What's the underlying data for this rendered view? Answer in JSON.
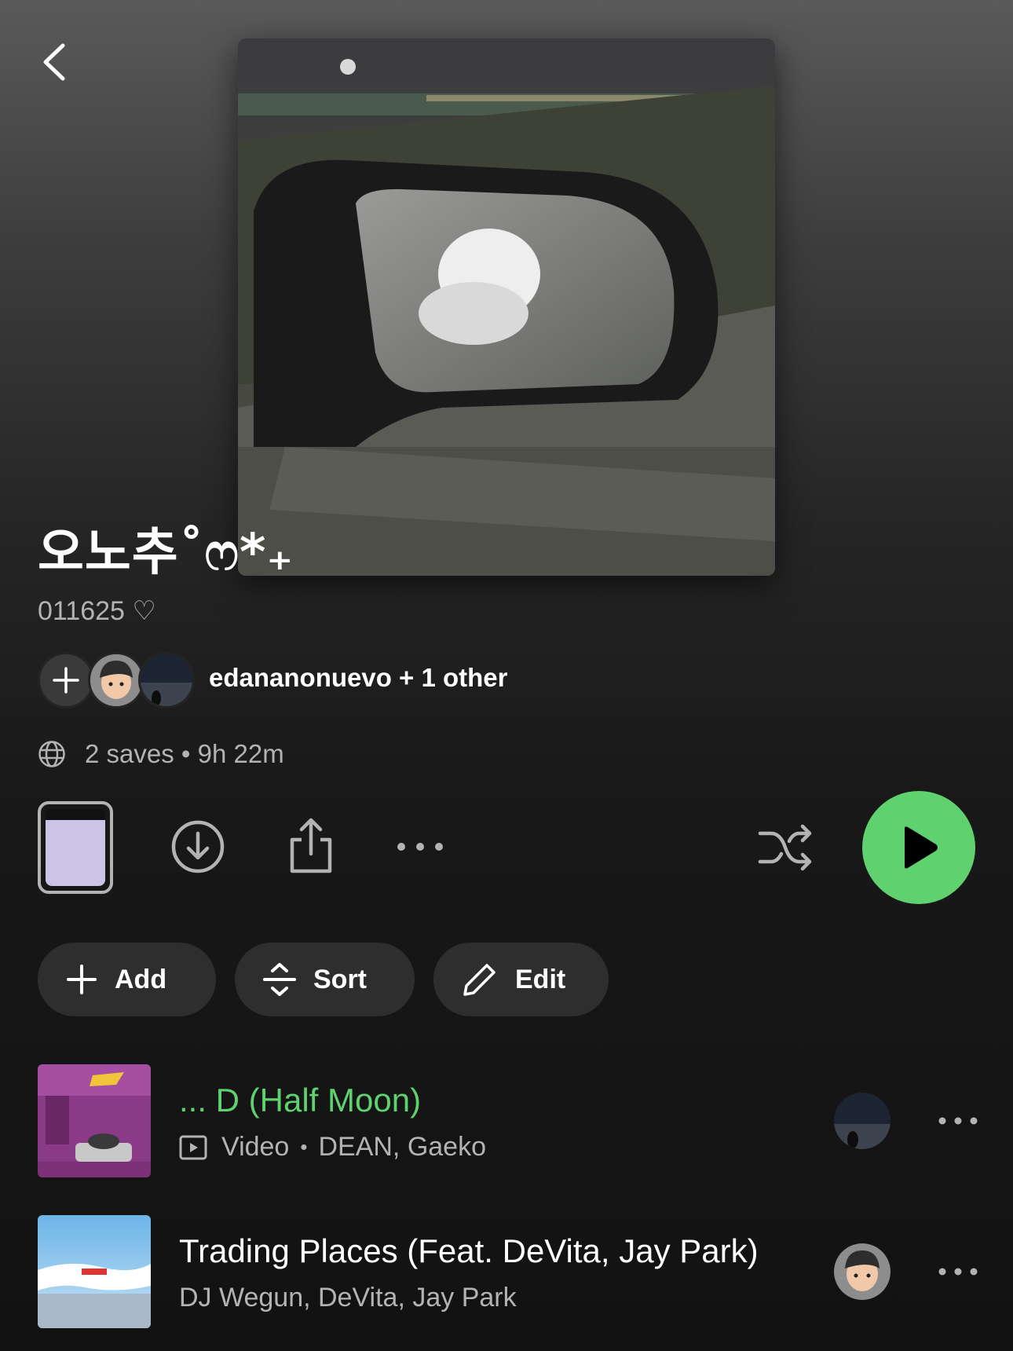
{
  "playlist": {
    "title": "오노추˚ෆ*₊",
    "description": "011625 ♡",
    "owners_text": "edananonuevo + 1 other",
    "meta_text": "2 saves • 9h 22m"
  },
  "actions": {
    "add_label": "Add",
    "sort_label": "Sort",
    "edit_label": "Edit"
  },
  "colors": {
    "accent_green": "#5fd16f",
    "text_secondary": "#b3b3b3",
    "pill_bg": "#2e2e2e"
  },
  "tracks": [
    {
      "title": "... D (Half Moon)",
      "type_label": "Video",
      "separator": "•",
      "artists": "DEAN, Gaeko",
      "playing": true
    },
    {
      "title": "Trading Places (Feat. DeVita, Jay Park)",
      "artists": "DJ Wegun, DeVita, Jay Park",
      "playing": false
    }
  ]
}
